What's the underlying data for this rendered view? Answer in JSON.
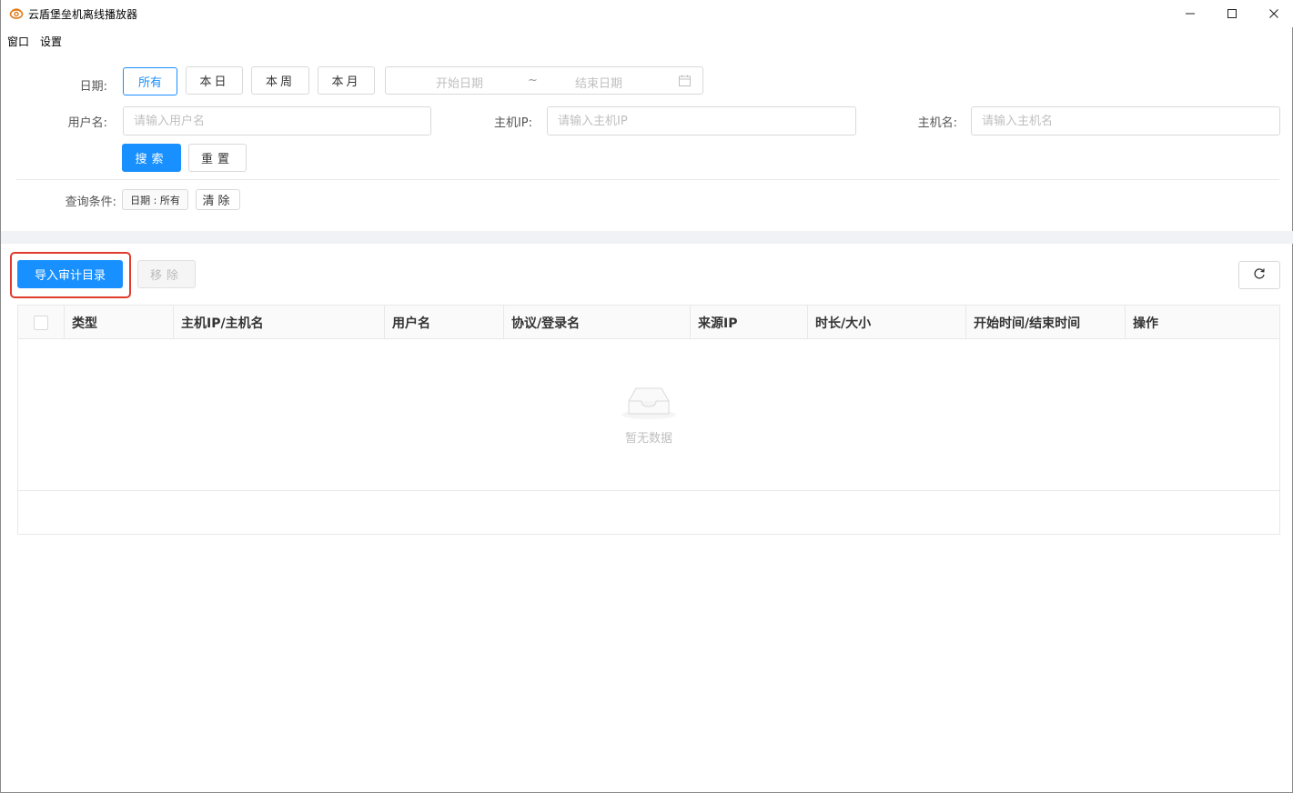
{
  "window": {
    "title": "云盾堡垒机离线播放器",
    "icon": "cloud-shield-logo-icon"
  },
  "menu": [
    "窗口",
    "设置"
  ],
  "filters": {
    "date_label": "日期:",
    "date_buttons": [
      "所有",
      "本日",
      "本周",
      "本月"
    ],
    "date_active": "所有",
    "start_placeholder": "开始日期",
    "range_separator": "~",
    "end_placeholder": "结束日期",
    "username_label": "用户名:",
    "username_placeholder": "请输入用户名",
    "host_ip_label": "主机IP:",
    "host_ip_placeholder": "请输入主机IP",
    "host_name_label": "主机名:",
    "host_name_placeholder": "请输入主机名",
    "search_label": "搜索",
    "reset_label": "重置",
    "conditions_label": "查询条件:",
    "condition_tags": [
      "日期 : 所有"
    ],
    "clear_label": "清除"
  },
  "toolbar": {
    "import_label": "导入审计目录",
    "remove_label": "移除"
  },
  "table": {
    "columns": [
      "类型",
      "主机IP/主机名",
      "用户名",
      "协议/登录名",
      "来源IP",
      "时长/大小",
      "开始时间/结束时间",
      "操作"
    ],
    "rows": [],
    "empty_text": "暂无数据"
  },
  "colors": {
    "primary": "#1890ff",
    "highlight": "#e03c2b"
  }
}
